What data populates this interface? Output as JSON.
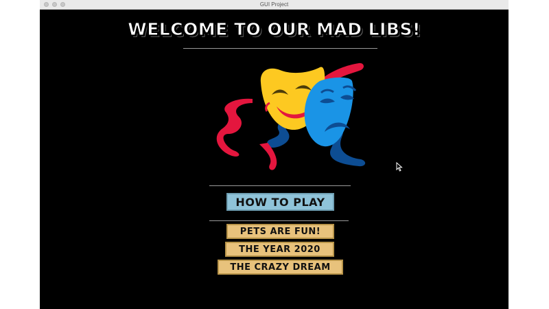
{
  "window": {
    "title": "GUI Project"
  },
  "app": {
    "heading": "WELCOME TO OUR MAD LIBS!",
    "image": "comedy-tragedy-masks",
    "how_to_play_label": "HOW TO PLAY",
    "stories": [
      {
        "label": "PETS ARE FUN!"
      },
      {
        "label": "THE YEAR 2020"
      },
      {
        "label": "THE CRAZY DREAM"
      }
    ]
  },
  "colors": {
    "background": "#000000",
    "how_to_play_button": "#8fc3d9",
    "story_button": "#e8c27c",
    "comedy_mask": "#fdc921",
    "tragedy_mask": "#1a94e6",
    "red_ribbon": "#e4163e",
    "blue_ribbon": "#0d4d93"
  }
}
